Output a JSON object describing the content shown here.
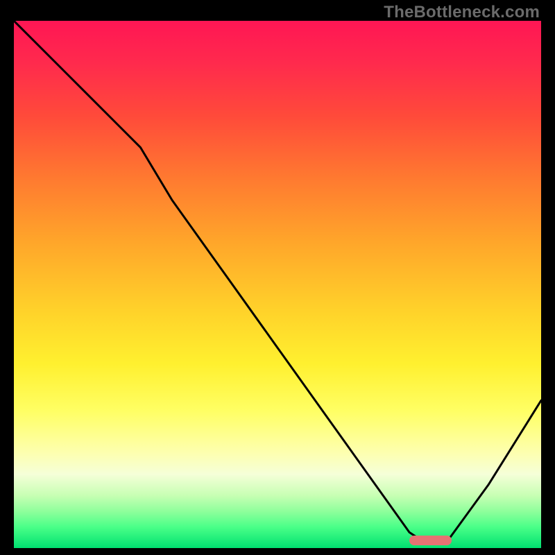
{
  "watermark": "TheBottleneck.com",
  "chart_data": {
    "type": "line",
    "title": "",
    "xlabel": "",
    "ylabel": "",
    "xlim": [
      0,
      100
    ],
    "ylim": [
      0,
      100
    ],
    "grid": false,
    "legend": false,
    "series": [
      {
        "name": "bottleneck-curve",
        "x": [
          0,
          10,
          20,
          24,
          30,
          40,
          50,
          60,
          70,
          75,
          78,
          82,
          90,
          100
        ],
        "y": [
          100,
          90,
          80,
          76,
          66,
          52,
          38,
          24,
          10,
          3,
          1,
          1,
          12,
          28
        ]
      }
    ],
    "annotations": [
      {
        "name": "optimal-zone",
        "x_start": 75,
        "x_end": 83,
        "y": 1.5
      }
    ],
    "gradient_stops": [
      {
        "pos": 0,
        "color": "#ff1654"
      },
      {
        "pos": 30,
        "color": "#ff7a30"
      },
      {
        "pos": 55,
        "color": "#ffd22a"
      },
      {
        "pos": 74,
        "color": "#ffff64"
      },
      {
        "pos": 90,
        "color": "#c8ffb4"
      },
      {
        "pos": 100,
        "color": "#00e070"
      }
    ]
  },
  "colors": {
    "curve": "#000000",
    "marker": "#e57373",
    "frame_bg": "#000000"
  }
}
